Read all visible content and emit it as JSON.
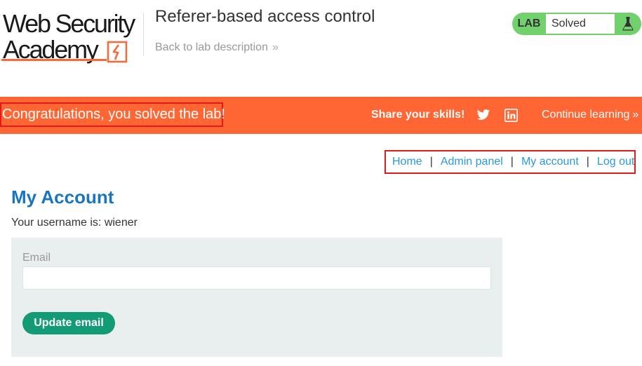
{
  "header": {
    "logo": {
      "line1": "Web Security",
      "line2": "Academy"
    },
    "lab_title": "Referer-based access control",
    "back_link": "Back to lab description",
    "back_chevron": "»",
    "status": {
      "label": "LAB",
      "value": "Solved",
      "icon": "flask-icon"
    }
  },
  "banner": {
    "message": "Congratulations, you solved the lab!",
    "share": "Share your skills!",
    "continue": "Continue learning",
    "continue_chevron": "»",
    "icons": [
      "twitter-icon",
      "linkedin-icon"
    ]
  },
  "nav": {
    "items": [
      "Home",
      "Admin panel",
      "My account",
      "Log out"
    ],
    "separator": "|"
  },
  "main": {
    "heading": "My Account",
    "username_text": "Your username is: wiener",
    "form": {
      "email_label": "Email",
      "email_value": "",
      "submit_label": "Update email"
    }
  },
  "colors": {
    "accent": "#ff6633",
    "link": "#2a9ad8",
    "heading": "#1a75bf",
    "solved": "#70d16d",
    "button": "#139b76"
  }
}
